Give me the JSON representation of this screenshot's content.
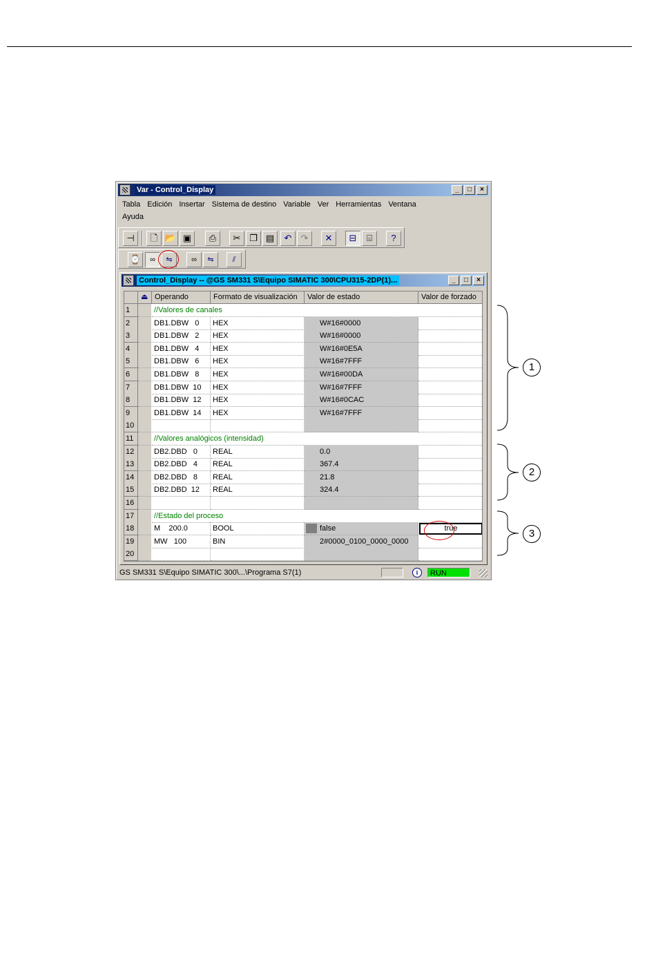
{
  "app": {
    "title": "Var - Control_Display",
    "window_buttons": [
      "_",
      "□",
      "×"
    ],
    "menu": [
      "Tabla",
      "Edición",
      "Insertar",
      "Sistema de destino",
      "Variable",
      "Ver",
      "Herramientas",
      "Ventana",
      "Ayuda"
    ]
  },
  "toolbar1": {
    "icons": [
      "pin-icon",
      "new-icon",
      "open-icon",
      "save-icon",
      "print-icon",
      "cut-icon",
      "copy-icon",
      "paste-icon",
      "undo-icon",
      "redo-icon",
      "delete-icon",
      "online-icon",
      "network-icon",
      "help-icon"
    ]
  },
  "toolbar2": {
    "icons": [
      "monitor-icon",
      "glasses-icon",
      "modify-icon",
      "glasses-update-icon",
      "modify-update-icon",
      "force-icon"
    ]
  },
  "child": {
    "title": "Control_Display -- @GS SM331 S\\Equipo SIMATIC 300\\CPU315-2DP(1)...",
    "window_buttons": [
      "_",
      "□",
      "×"
    ]
  },
  "grid": {
    "headers": [
      "Operando",
      "Formato de visualización",
      "Valor de estado",
      "Valor de forzado"
    ],
    "rows": [
      {
        "n": "1",
        "comment": "//Valores de canales"
      },
      {
        "n": "2",
        "op": "DB1.DBW   0",
        "fmt": "HEX",
        "val": "W#16#0000",
        "frc": ""
      },
      {
        "n": "3",
        "op": "DB1.DBW   2",
        "fmt": "HEX",
        "val": "W#16#0000",
        "frc": ""
      },
      {
        "n": "4",
        "op": "DB1.DBW   4",
        "fmt": "HEX",
        "val": "W#16#0E5A",
        "frc": ""
      },
      {
        "n": "5",
        "op": "DB1.DBW   6",
        "fmt": "HEX",
        "val": "W#16#7FFF",
        "frc": ""
      },
      {
        "n": "6",
        "op": "DB1.DBW   8",
        "fmt": "HEX",
        "val": "W#16#00DA",
        "frc": ""
      },
      {
        "n": "7",
        "op": "DB1.DBW  10",
        "fmt": "HEX",
        "val": "W#16#7FFF",
        "frc": ""
      },
      {
        "n": "8",
        "op": "DB1.DBW  12",
        "fmt": "HEX",
        "val": "W#16#0CAC",
        "frc": ""
      },
      {
        "n": "9",
        "op": "DB1.DBW  14",
        "fmt": "HEX",
        "val": "W#16#7FFF",
        "frc": ""
      },
      {
        "n": "10",
        "op": "",
        "fmt": "",
        "val": "",
        "frc": ""
      },
      {
        "n": "11",
        "comment": "//Valores analógicos (intensidad)"
      },
      {
        "n": "12",
        "op": "DB2.DBD   0",
        "fmt": "REAL",
        "val": "0.0",
        "frc": ""
      },
      {
        "n": "13",
        "op": "DB2.DBD   4",
        "fmt": "REAL",
        "val": "367.4",
        "frc": ""
      },
      {
        "n": "14",
        "op": "DB2.DBD   8",
        "fmt": "REAL",
        "val": "21.8",
        "frc": ""
      },
      {
        "n": "15",
        "op": "DB2.DBD  12",
        "fmt": "REAL",
        "val": "324.4",
        "frc": ""
      },
      {
        "n": "16",
        "op": "",
        "fmt": "",
        "val": "",
        "frc": ""
      },
      {
        "n": "17",
        "comment": "//Estado del proceso"
      },
      {
        "n": "18",
        "op": "M    200.0",
        "fmt": "BOOL",
        "val": "false",
        "frc": "true",
        "val_box": true
      },
      {
        "n": "19",
        "op": "MW   100",
        "fmt": "BIN",
        "val": "2#0000_0100_0000_0000",
        "frc": ""
      },
      {
        "n": "20",
        "op": "",
        "fmt": "",
        "val": "",
        "frc": ""
      }
    ]
  },
  "statusbar": {
    "path": "GS SM331 S\\Equipo SIMATIC 300\\...\\Programa S7(1)",
    "mode": "RUN",
    "mode_color": "#00e000"
  },
  "callouts": [
    "1",
    "2",
    "3"
  ]
}
